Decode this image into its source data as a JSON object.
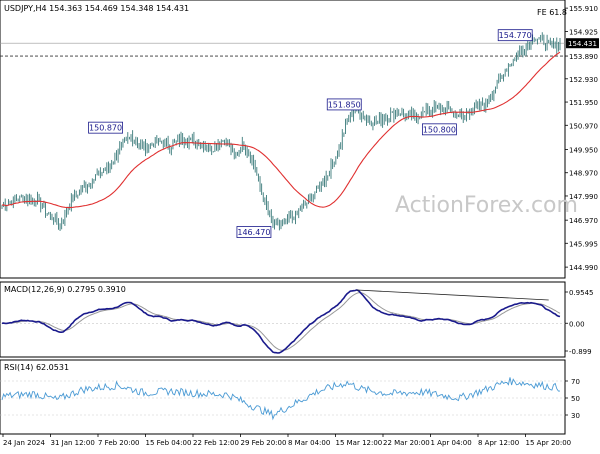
{
  "colors": {
    "price_bar": "#3a7a7a",
    "ma_line": "#e03030",
    "macd_line": "#1a1a8c",
    "macd_signal": "#999999",
    "macd_trend": "#222222",
    "rsi_line": "#4a9ad4",
    "label_box": "#1a1a8c",
    "grid_dash": "#333333"
  },
  "header": {
    "symbol_info": "USDJPY,H4  154.363 154.469 154.348 154.431",
    "fib_label": "FE 61.8"
  },
  "watermark": "ActionForex.com",
  "price_panel": {
    "price_axis": [
      "155.910",
      "154.925",
      "153.890",
      "152.930",
      "151.950",
      "150.970",
      "149.950",
      "148.970",
      "147.990",
      "146.970",
      "145.995",
      "144.990"
    ],
    "current_price": "154.431",
    "dashed_level": "153.890",
    "annotations": [
      {
        "label": "154.770",
        "price": 154.77,
        "bar": 330
      },
      {
        "label": "151.850",
        "price": 151.85,
        "bar": 224
      },
      {
        "label": "150.870",
        "price": 150.87,
        "bar": 76
      },
      {
        "label": "150.800",
        "price": 150.8,
        "bar": 283
      },
      {
        "label": "146.470",
        "price": 146.47,
        "bar": 168
      }
    ]
  },
  "macd_panel": {
    "label": "MACD(12,26,9) 0.2795 0.3910",
    "axis": [
      "0.9545",
      "0.00",
      "-0.899"
    ]
  },
  "rsi_panel": {
    "label": "RSI(14) 62.0531",
    "axis": [
      "70",
      "50",
      "30"
    ]
  },
  "time_axis": [
    "24 Jan 2024",
    "31 Jan 12:00",
    "7 Feb 20:00",
    "15 Feb 04:00",
    "22 Feb 12:00",
    "29 Feb 20:00",
    "8 Mar 04:00",
    "15 Mar 12:00",
    "22 Mar 20:00",
    "1 Apr 04:00",
    "8 Apr 12:00",
    "15 Apr 20:00"
  ],
  "chart_data": {
    "type": "line",
    "series_kind": "ohlc_bars",
    "ylim": [
      144.7,
      156.0
    ],
    "keypoints": [
      [
        0,
        147.6
      ],
      [
        12,
        147.9
      ],
      [
        22,
        147.8
      ],
      [
        30,
        147.1
      ],
      [
        36,
        146.8
      ],
      [
        44,
        147.9
      ],
      [
        50,
        148.3
      ],
      [
        58,
        148.8
      ],
      [
        66,
        149.2
      ],
      [
        74,
        150.1
      ],
      [
        80,
        150.5
      ],
      [
        88,
        150.0
      ],
      [
        96,
        150.3
      ],
      [
        104,
        150.1
      ],
      [
        112,
        150.4
      ],
      [
        120,
        150.3
      ],
      [
        130,
        150.0
      ],
      [
        138,
        150.4
      ],
      [
        144,
        149.7
      ],
      [
        150,
        150.2
      ],
      [
        156,
        149.3
      ],
      [
        162,
        147.9
      ],
      [
        168,
        146.8
      ],
      [
        174,
        146.8
      ],
      [
        182,
        147.2
      ],
      [
        190,
        147.8
      ],
      [
        196,
        148.3
      ],
      [
        202,
        148.9
      ],
      [
        208,
        149.8
      ],
      [
        214,
        151.2
      ],
      [
        220,
        151.7
      ],
      [
        226,
        151.2
      ],
      [
        232,
        151.1
      ],
      [
        240,
        151.4
      ],
      [
        248,
        151.5
      ],
      [
        256,
        151.3
      ],
      [
        264,
        151.6
      ],
      [
        272,
        151.7
      ],
      [
        278,
        151.6
      ],
      [
        286,
        151.3
      ],
      [
        292,
        151.7
      ],
      [
        300,
        151.9
      ],
      [
        306,
        152.6
      ],
      [
        312,
        153.3
      ],
      [
        318,
        153.8
      ],
      [
        324,
        154.3
      ],
      [
        330,
        154.7
      ],
      [
        336,
        154.5
      ],
      [
        342,
        154.3
      ],
      [
        346,
        154.43
      ]
    ],
    "rsi_keypoints": [
      [
        0,
        52
      ],
      [
        20,
        55
      ],
      [
        34,
        48
      ],
      [
        50,
        60
      ],
      [
        72,
        65
      ],
      [
        88,
        56
      ],
      [
        104,
        58
      ],
      [
        124,
        55
      ],
      [
        140,
        54
      ],
      [
        156,
        40
      ],
      [
        168,
        30
      ],
      [
        176,
        38
      ],
      [
        196,
        58
      ],
      [
        214,
        68
      ],
      [
        224,
        60
      ],
      [
        240,
        55
      ],
      [
        260,
        57
      ],
      [
        284,
        50
      ],
      [
        300,
        60
      ],
      [
        314,
        70
      ],
      [
        330,
        66
      ],
      [
        346,
        62
      ]
    ],
    "total_bars": 347
  }
}
